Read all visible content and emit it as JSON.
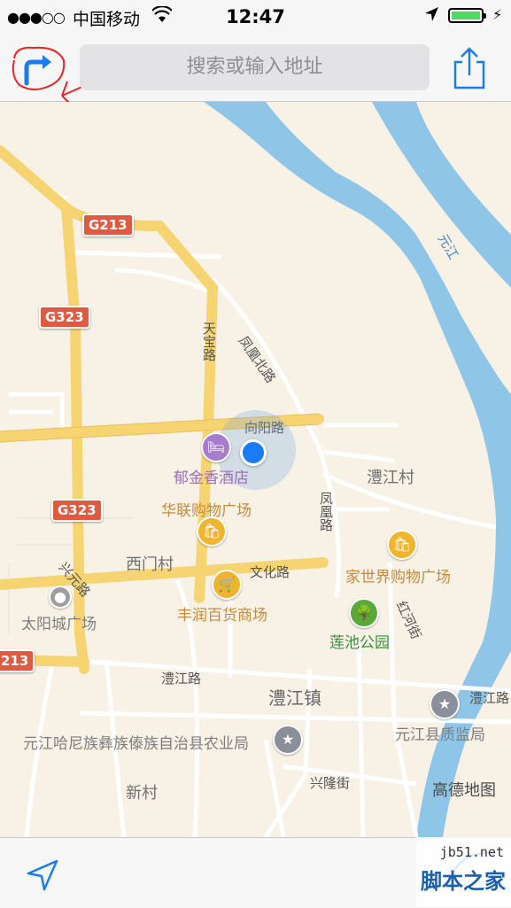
{
  "status_bar": {
    "signal": "●●●○○",
    "carrier": "中国移动",
    "time": "12:47"
  },
  "nav": {
    "search_placeholder": "搜索或输入地址"
  },
  "map": {
    "shields": [
      "G213",
      "G323",
      "G323",
      "213"
    ],
    "roads": {
      "tianbao": "天宝路",
      "fenghuang_north": "凤凰北路",
      "xiangyang": "向阳路",
      "fenghuang": "凤凰路",
      "wenhua": "文化路",
      "xingyuan": "兴元路",
      "lijiang": "澧江路",
      "hongbin": "红河街",
      "xinglong": "兴隆街",
      "lijiang_right": "澧江路",
      "yuanjiang_river": "元江"
    },
    "places": {
      "hotel": "郁金香酒店",
      "hualian": "华联购物广场",
      "ximen": "西门村",
      "fengrun": "丰润百货商场",
      "taiyang": "太阳城广场",
      "lijiang_village": "澧江村",
      "jiashijie": "家世界购物广场",
      "lianchi": "莲池公园",
      "lijiang_town": "澧江镇",
      "agri_bureau": "元江哈尼族彝族傣族自治县农业局",
      "quality_bureau": "元江县质监局",
      "xincun": "新村"
    },
    "map_brand": "高德地图"
  },
  "watermark": {
    "site": "jb51.net",
    "name": "脚本之家"
  },
  "colors": {
    "land": "#f7f1e6",
    "river": "#8fc6e8",
    "highway": "#f7d472",
    "accent": "#1a7cf5"
  }
}
